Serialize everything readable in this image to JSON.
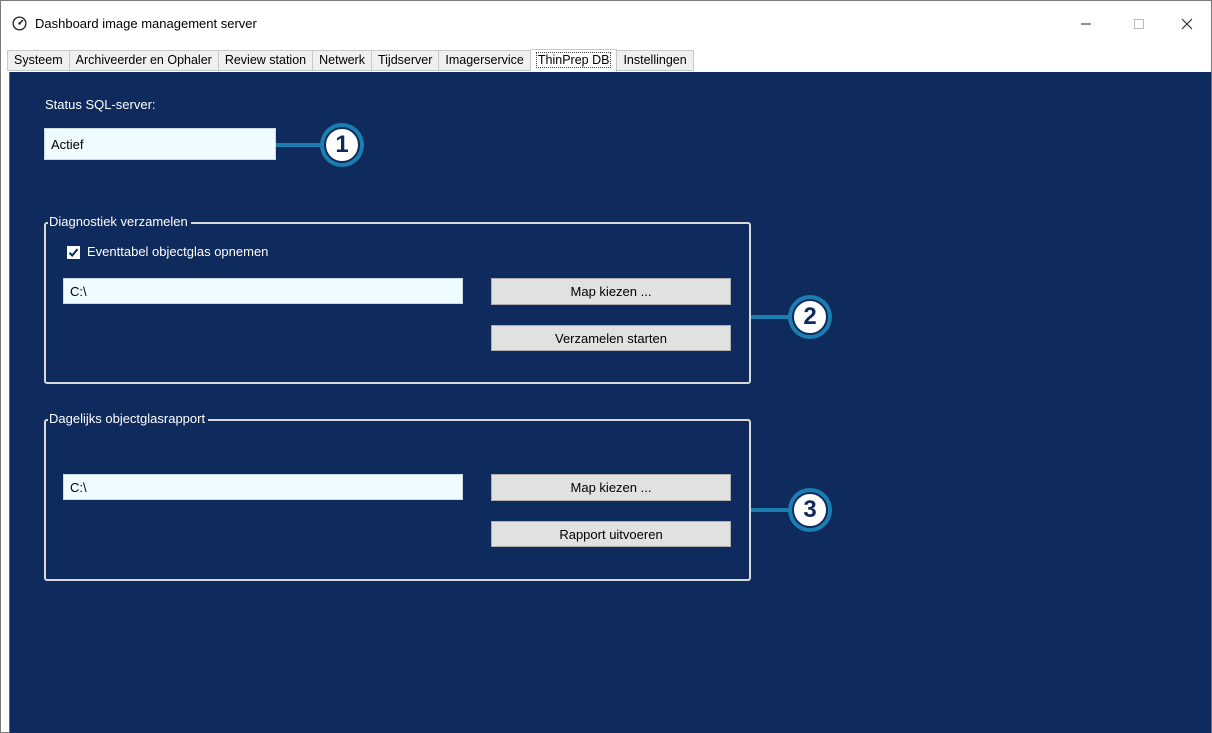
{
  "window": {
    "title": "Dashboard image management server",
    "minimize_glyph": "—",
    "maximize_glyph": "☐",
    "close_glyph": "✕"
  },
  "tabs": [
    {
      "label": "Systeem"
    },
    {
      "label": "Archiveerder en Ophaler"
    },
    {
      "label": "Review station"
    },
    {
      "label": "Netwerk"
    },
    {
      "label": "Tijdserver"
    },
    {
      "label": "Imagerservice"
    },
    {
      "label": "ThinPrep DB",
      "active": true
    },
    {
      "label": "Instellingen"
    }
  ],
  "sql_status": {
    "label": "Status SQL-server:",
    "value": "Actief"
  },
  "diagnostics": {
    "legend": "Diagnostiek verzamelen",
    "checkbox_label": "Eventtabel objectglas opnemen",
    "checkbox_checked": true,
    "path_value": "C:\\",
    "choose_folder_label": "Map kiezen ...",
    "start_label": "Verzamelen starten"
  },
  "daily_report": {
    "legend": "Dagelijks objectglasrapport",
    "path_value": "C:\\",
    "choose_folder_label": "Map kiezen ...",
    "run_label": "Rapport uitvoeren"
  },
  "callouts": [
    "1",
    "2",
    "3"
  ],
  "colors": {
    "panel_bg": "#0f2a5c",
    "field_bg": "#eefcff",
    "callout_accent": "#1a7fb0"
  },
  "icons": {
    "app": "speedometer-icon",
    "check": "checkmark-icon"
  }
}
